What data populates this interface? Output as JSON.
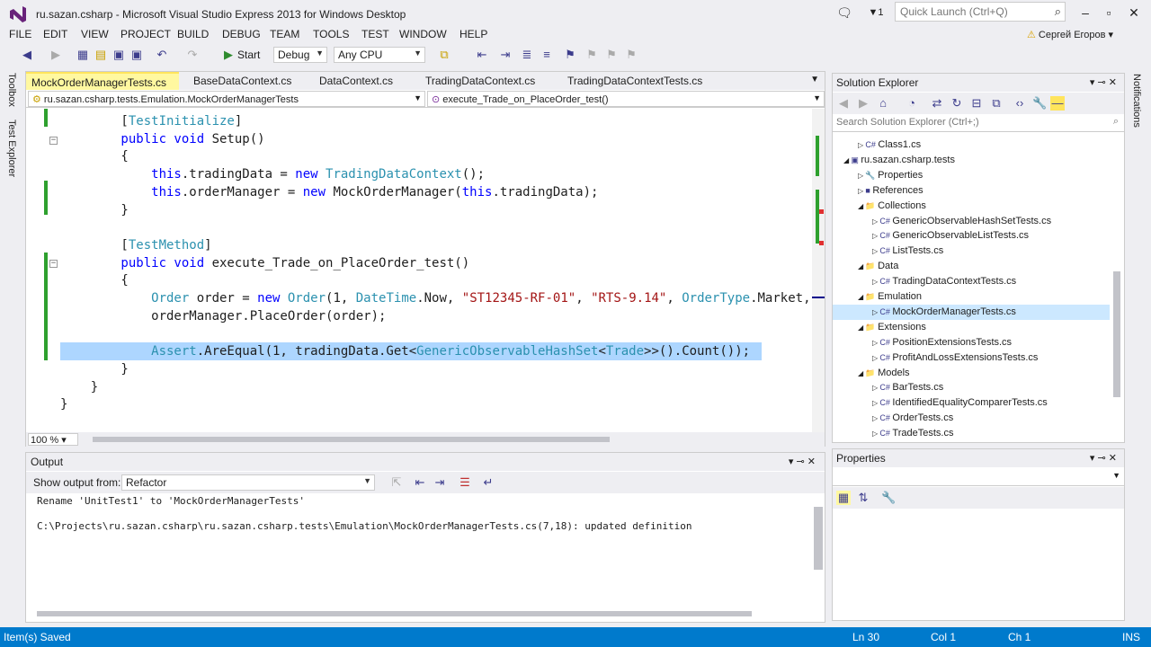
{
  "window": {
    "title": "ru.sazan.csharp - Microsoft Visual Studio Express 2013 for Windows Desktop",
    "quick_launch_placeholder": "Quick Launch (Ctrl+Q)",
    "notif_count": "1",
    "user": "Сергей Егоров"
  },
  "menu": [
    "FILE",
    "EDIT",
    "VIEW",
    "PROJECT",
    "BUILD",
    "DEBUG",
    "TEAM",
    "TOOLS",
    "TEST",
    "WINDOW",
    "HELP"
  ],
  "toolbar": {
    "start": "Start",
    "config": "Debug",
    "platform": "Any CPU"
  },
  "sidebar": {
    "toolbox": "Toolbox",
    "test_explorer": "Test Explorer",
    "notifications": "Notifications"
  },
  "editor": {
    "tabs": [
      "MockOrderManagerTests.cs",
      "BaseDataContext.cs",
      "DataContext.cs",
      "TradingDataContext.cs",
      "TradingDataContextTests.cs"
    ],
    "nav_left": "ru.sazan.csharp.tests.Emulation.MockOrderManagerTests",
    "nav_right": "execute_Trade_on_PlaceOrder_test()",
    "zoom": "100 %",
    "lines": [
      {
        "t": [
          [
            "pl",
            "        ["
          ],
          [
            "ty",
            "TestInitialize"
          ],
          [
            "pl",
            "]"
          ]
        ]
      },
      {
        "t": [
          [
            "kw",
            "        public void "
          ],
          [
            "pl",
            "Setup()"
          ]
        ]
      },
      {
        "t": [
          [
            "pl",
            "        {"
          ]
        ]
      },
      {
        "t": [
          [
            "kw",
            "            this"
          ],
          [
            "pl",
            ".tradingData = "
          ],
          [
            "kw",
            "new "
          ],
          [
            "ty",
            "TradingDataContext"
          ],
          [
            "pl",
            "();"
          ]
        ]
      },
      {
        "t": [
          [
            "kw",
            "            this"
          ],
          [
            "pl",
            ".orderManager = "
          ],
          [
            "kw",
            "new "
          ],
          [
            "pl",
            "MockOrderManager("
          ],
          [
            "kw",
            "this"
          ],
          [
            "pl",
            ".tradingData);"
          ]
        ]
      },
      {
        "t": [
          [
            "pl",
            "        }"
          ]
        ]
      },
      {
        "t": [
          [
            "pl",
            ""
          ]
        ]
      },
      {
        "t": [
          [
            "pl",
            "        ["
          ],
          [
            "ty",
            "TestMethod"
          ],
          [
            "pl",
            "]"
          ]
        ]
      },
      {
        "t": [
          [
            "kw",
            "        public void "
          ],
          [
            "pl",
            "execute_Trade_on_PlaceOrder_test()"
          ]
        ]
      },
      {
        "t": [
          [
            "pl",
            "        {"
          ]
        ]
      },
      {
        "t": [
          [
            "ty",
            "            Order "
          ],
          [
            "pl",
            "order = "
          ],
          [
            "kw",
            "new "
          ],
          [
            "ty",
            "Order"
          ],
          [
            "pl",
            "(1, "
          ],
          [
            "ty",
            "DateTime"
          ],
          [
            "pl",
            ".Now, "
          ],
          [
            "st",
            "\"ST12345-RF-01\""
          ],
          [
            "pl",
            ", "
          ],
          [
            "st",
            "\"RTS-9.14\""
          ],
          [
            "pl",
            ", "
          ],
          [
            "ty",
            "OrderType"
          ],
          [
            "pl",
            ".Market,"
          ]
        ]
      },
      {
        "t": [
          [
            "pl",
            "            orderManager.PlaceOrder(order);"
          ]
        ]
      },
      {
        "t": [
          [
            "pl",
            ""
          ]
        ]
      },
      {
        "t": [
          [
            "ty",
            "            Assert"
          ],
          [
            "pl",
            ".AreEqual(1, tradingData.Get<"
          ],
          [
            "ty",
            "GenericObservableHashSet"
          ],
          [
            "pl",
            "<"
          ],
          [
            "ty",
            "Trade"
          ],
          [
            "pl",
            ">>().Count());"
          ]
        ],
        "hl": true
      },
      {
        "t": [
          [
            "pl",
            "        }"
          ]
        ]
      },
      {
        "t": [
          [
            "pl",
            "    }"
          ]
        ]
      },
      {
        "t": [
          [
            "pl",
            "}"
          ]
        ]
      }
    ]
  },
  "output": {
    "title": "Output",
    "show_from_label": "Show output from:",
    "source": "Refactor",
    "lines": [
      "Rename 'UnitTest1' to 'MockOrderManagerTests'",
      "",
      "C:\\Projects\\ru.sazan.csharp\\ru.sazan.csharp.tests\\Emulation\\MockOrderManagerTests.cs(7,18): updated definition"
    ]
  },
  "solution_explorer": {
    "title": "Solution Explorer",
    "search_placeholder": "Search Solution Explorer (Ctrl+;)",
    "items": [
      {
        "label": "Class1.cs",
        "level": 2,
        "kind": "cs"
      },
      {
        "label": "ru.sazan.csharp.tests",
        "level": 1,
        "kind": "proj"
      },
      {
        "label": "Properties",
        "level": 2,
        "kind": "prop"
      },
      {
        "label": "References",
        "level": 2,
        "kind": "ref"
      },
      {
        "label": "Collections",
        "level": 2,
        "kind": "folder"
      },
      {
        "label": "GenericObservableHashSetTests.cs",
        "level": 3,
        "kind": "cs"
      },
      {
        "label": "GenericObservableListTests.cs",
        "level": 3,
        "kind": "cs"
      },
      {
        "label": "ListTests.cs",
        "level": 3,
        "kind": "cs"
      },
      {
        "label": "Data",
        "level": 2,
        "kind": "folder"
      },
      {
        "label": "TradingDataContextTests.cs",
        "level": 3,
        "kind": "cs"
      },
      {
        "label": "Emulation",
        "level": 2,
        "kind": "folder"
      },
      {
        "label": "MockOrderManagerTests.cs",
        "level": 3,
        "kind": "cs",
        "selected": true
      },
      {
        "label": "Extensions",
        "level": 2,
        "kind": "folder"
      },
      {
        "label": "PositionExtensionsTests.cs",
        "level": 3,
        "kind": "cs"
      },
      {
        "label": "ProfitAndLossExtensionsTests.cs",
        "level": 3,
        "kind": "cs"
      },
      {
        "label": "Models",
        "level": 2,
        "kind": "folder"
      },
      {
        "label": "BarTests.cs",
        "level": 3,
        "kind": "cs"
      },
      {
        "label": "IdentifiedEqualityComparerTests.cs",
        "level": 3,
        "kind": "cs"
      },
      {
        "label": "OrderTests.cs",
        "level": 3,
        "kind": "cs"
      },
      {
        "label": "TradeTests.cs",
        "level": 3,
        "kind": "cs"
      }
    ]
  },
  "properties": {
    "title": "Properties"
  },
  "status": {
    "left": "Item(s) Saved",
    "ln": "Ln 30",
    "col": "Col 1",
    "ch": "Ch 1",
    "ins": "INS"
  },
  "colors": {
    "status_bg": "#007acc",
    "keyword": "#0000ff",
    "type": "#2b91af",
    "string": "#a31515",
    "selection": "#add6ff",
    "active_tab": "#fff8a0"
  }
}
